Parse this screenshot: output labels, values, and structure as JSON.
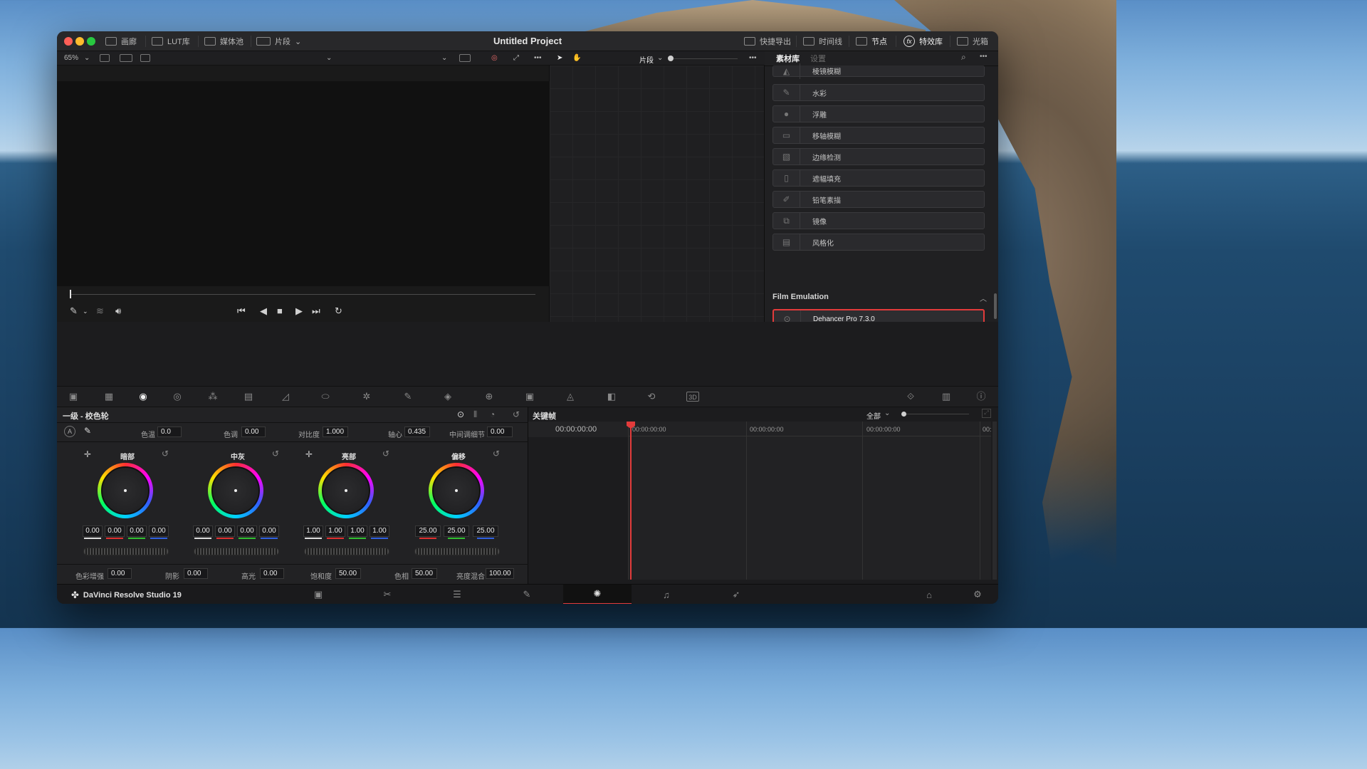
{
  "window": {
    "title": "Untitled Project",
    "top_tabs": [
      "画廊",
      "LUT库",
      "媒体池",
      "片段"
    ],
    "right_tabs": [
      "快捷导出",
      "时间线",
      "节点",
      "特效库",
      "光箱"
    ]
  },
  "viewer": {
    "zoom": "65%",
    "clip_label": "片段"
  },
  "library": {
    "tabs": [
      "素材库",
      "设置"
    ],
    "items": [
      "棱镜模糊",
      "水彩",
      "浮雕",
      "移轴模糊",
      "边缘检测",
      "遮幅填充",
      "铅笔素描",
      "镜像",
      "风格化"
    ],
    "section": "Film Emulation",
    "selected_item": "Dehancer Pro 7.3.0"
  },
  "wheels_panel": {
    "title": "一级 - 校色轮",
    "params_top": [
      {
        "label": "色温",
        "value": "0.0"
      },
      {
        "label": "色调",
        "value": "0.00"
      },
      {
        "label": "对比度",
        "value": "1.000"
      },
      {
        "label": "轴心",
        "value": "0.435"
      },
      {
        "label": "中间调细节",
        "value": "0.00"
      }
    ],
    "wheels": [
      {
        "title": "暗部",
        "values": [
          "0.00",
          "0.00",
          "0.00",
          "0.00"
        ]
      },
      {
        "title": "中灰",
        "values": [
          "0.00",
          "0.00",
          "0.00",
          "0.00"
        ]
      },
      {
        "title": "亮部",
        "values": [
          "1.00",
          "1.00",
          "1.00",
          "1.00"
        ]
      },
      {
        "title": "偏移",
        "values": [
          "25.00",
          "25.00",
          "25.00"
        ]
      }
    ],
    "params_bottom": [
      {
        "label": "色彩增强",
        "value": "0.00"
      },
      {
        "label": "阴影",
        "value": "0.00"
      },
      {
        "label": "高光",
        "value": "0.00"
      },
      {
        "label": "饱和度",
        "value": "50.00"
      },
      {
        "label": "色相",
        "value": "50.00"
      },
      {
        "label": "亮度混合",
        "value": "100.00"
      }
    ]
  },
  "keyframes": {
    "title": "关键帧",
    "filter": "全部",
    "timecode": "00:00:00:00",
    "ruler": [
      "00:00:00:00",
      "00:00:00:00",
      "00:00:00:00",
      "00:"
    ]
  },
  "footer": {
    "app_name": "DaVinci Resolve Studio 19"
  },
  "colors": {
    "accent": "#e23b3b",
    "panel": "#222224"
  }
}
